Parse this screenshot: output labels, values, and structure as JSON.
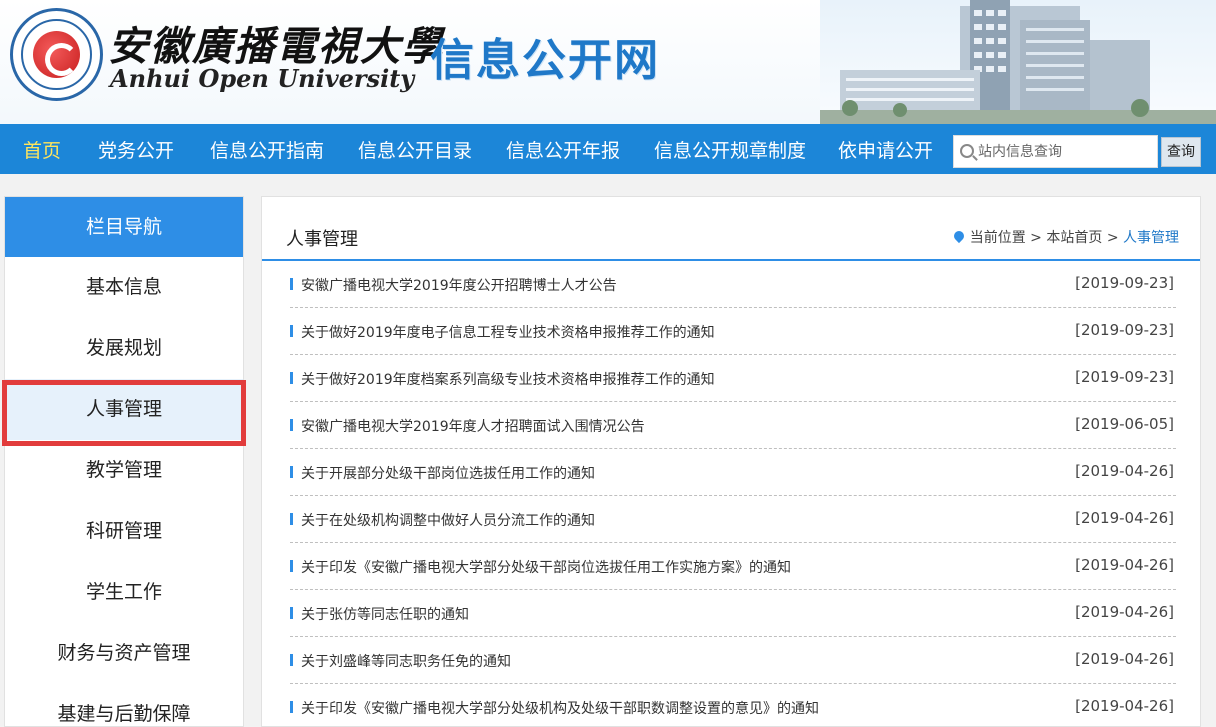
{
  "header": {
    "univ_cn": "安徽廣播電視大學",
    "univ_en": "Anhui Open University",
    "site_title": "信息公开网"
  },
  "nav": {
    "items": [
      "首页",
      "党务公开",
      "信息公开指南",
      "信息公开目录",
      "信息公开年报",
      "信息公开规章制度",
      "依申请公开"
    ],
    "active_index": 0
  },
  "search": {
    "placeholder": "站内信息查询",
    "button": "查询"
  },
  "sidebar": {
    "heading": "栏目导航",
    "items": [
      "基本信息",
      "发展规划",
      "人事管理",
      "教学管理",
      "科研管理",
      "学生工作",
      "财务与资产管理",
      "基建与后勤保障"
    ],
    "active_index": 2
  },
  "main": {
    "title": "人事管理",
    "breadcrumb": {
      "prefix": "当前位置",
      "sep": ">",
      "home": "本站首页",
      "current": "人事管理"
    },
    "news": [
      {
        "title": "安徽广播电视大学2019年度公开招聘博士人才公告",
        "date": "[2019-09-23]"
      },
      {
        "title": "关于做好2019年度电子信息工程专业技术资格申报推荐工作的通知",
        "date": "[2019-09-23]"
      },
      {
        "title": "关于做好2019年度档案系列高级专业技术资格申报推荐工作的通知",
        "date": "[2019-09-23]"
      },
      {
        "title": "安徽广播电视大学2019年度人才招聘面试入围情况公告",
        "date": "[2019-06-05]"
      },
      {
        "title": "关于开展部分处级干部岗位选拔任用工作的通知",
        "date": "[2019-04-26]"
      },
      {
        "title": "关于在处级机构调整中做好人员分流工作的通知",
        "date": "[2019-04-26]"
      },
      {
        "title": "关于印发《安徽广播电视大学部分处级干部岗位选拔任用工作实施方案》的通知",
        "date": "[2019-04-26]"
      },
      {
        "title": "关于张仿等同志任职的通知",
        "date": "[2019-04-26]"
      },
      {
        "title": "关于刘盛峰等同志职务任免的通知",
        "date": "[2019-04-26]"
      },
      {
        "title": "关于印发《安徽广播电视大学部分处级机构及处级干部职数调整设置的意见》的通知",
        "date": "[2019-04-26]"
      }
    ]
  },
  "colors": {
    "nav_bg": "#1c86d8",
    "nav_active": "#ffe55c",
    "accent": "#2e8ee6",
    "highlight": "#e23c3c"
  }
}
